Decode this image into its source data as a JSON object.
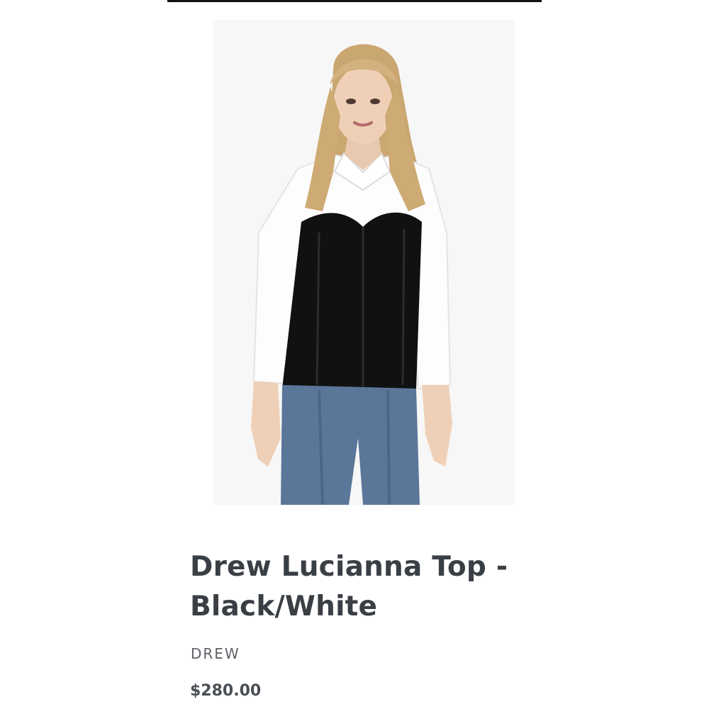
{
  "product": {
    "title": "Drew Lucianna Top - Black/White",
    "brand": "DREW",
    "price": "$280.00",
    "image": {
      "alt": "Drew Lucianna Top - Black/White",
      "background": "#f7f7f7"
    }
  },
  "colors": {
    "title_text": "#3a3f45",
    "brand_text": "#5d6166",
    "price_text": "#4a4f55",
    "top_rule": "#111111"
  }
}
